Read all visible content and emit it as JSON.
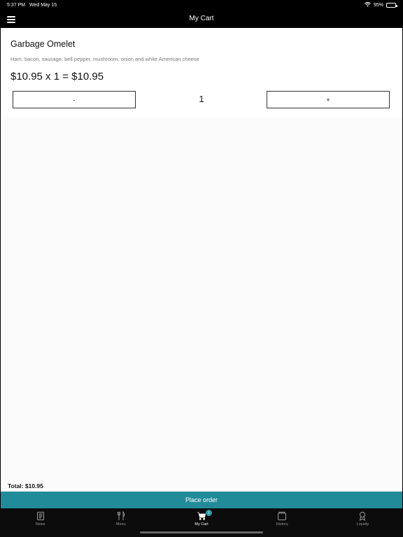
{
  "status_bar": {
    "time": "5:37 PM",
    "date": "Wed May 15",
    "battery": "95%",
    "battery_level": 0.95
  },
  "nav": {
    "title": "My Cart"
  },
  "cart": {
    "item": {
      "name": "Garbage Omelet",
      "description": "Ham, bacon, sausage, bell pepper, mushroom, onion and white American cheese",
      "price_line": "$10.95 x 1 = $10.95",
      "minus_label": "-",
      "plus_label": "+",
      "quantity": "1"
    },
    "total": "Total: $10.95",
    "place_order": "Place order"
  },
  "tabs": [
    {
      "label": "News",
      "icon": "news-icon",
      "active": false
    },
    {
      "label": "Menu",
      "icon": "fork-knife-icon",
      "active": false
    },
    {
      "label": "My Cart",
      "icon": "cart-icon",
      "active": true,
      "badge": "1"
    },
    {
      "label": "History",
      "icon": "history-icon",
      "active": false
    },
    {
      "label": "Loyalty",
      "icon": "award-icon",
      "active": false
    }
  ],
  "colors": {
    "accent": "#228b9a",
    "badge": "#2a9aa8",
    "tab_inactive": "#9a9a9a"
  }
}
